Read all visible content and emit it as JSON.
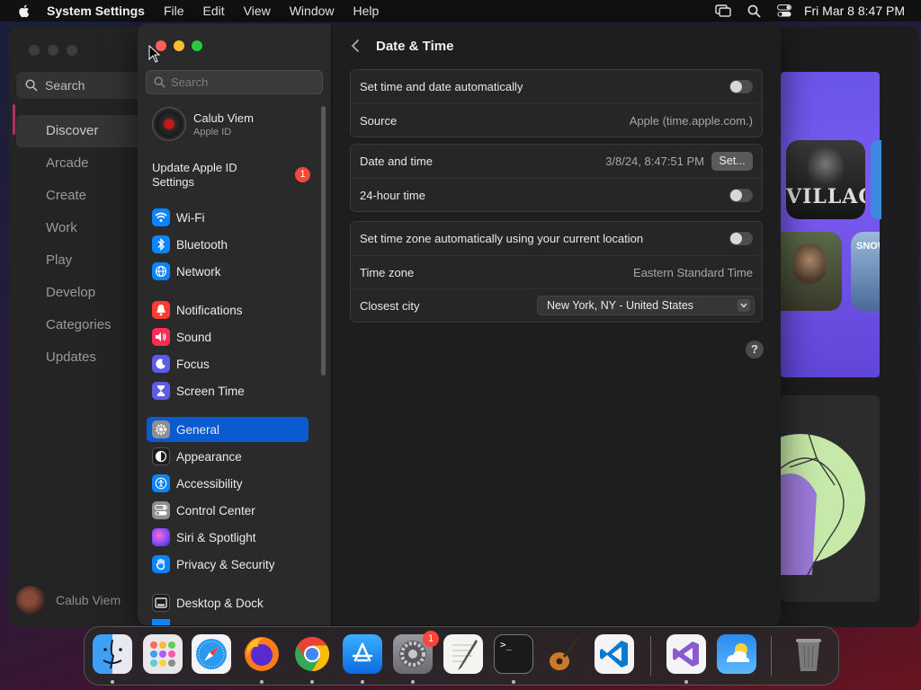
{
  "menubar": {
    "app_name": "System Settings",
    "menus": [
      "File",
      "Edit",
      "View",
      "Window",
      "Help"
    ],
    "clock": "Fri Mar 8  8:47 PM"
  },
  "bg_window": {
    "search_placeholder": "Search",
    "nav": [
      "Discover",
      "Arcade",
      "Create",
      "Work",
      "Play",
      "Develop",
      "Categories",
      "Updates"
    ],
    "active_nav": "Discover",
    "user_name": "Calub Viem",
    "tiles": {
      "village": "VILLAGE",
      "snow": "SNOW"
    }
  },
  "sidebar": {
    "search_placeholder": "Search",
    "account_name": "Calub Viem",
    "account_sub": "Apple ID",
    "update_label": "Update Apple ID Settings",
    "update_badge": "1",
    "items": [
      {
        "label": "Wi-Fi",
        "icon": "wifi-icon",
        "color": "#0a84ff"
      },
      {
        "label": "Bluetooth",
        "icon": "bluetooth-icon",
        "color": "#0a84ff"
      },
      {
        "label": "Network",
        "icon": "globe-icon",
        "color": "#0a84ff"
      },
      {
        "label": "Notifications",
        "icon": "bell-icon",
        "color": "#ff3b30"
      },
      {
        "label": "Sound",
        "icon": "speaker-icon",
        "color": "#ff2d55"
      },
      {
        "label": "Focus",
        "icon": "moon-icon",
        "color": "#5e5ce6"
      },
      {
        "label": "Screen Time",
        "icon": "hourglass-icon",
        "color": "#5e5ce6"
      },
      {
        "label": "General",
        "icon": "gear-icon",
        "color": "#8e8e93"
      },
      {
        "label": "Appearance",
        "icon": "appearance-icon",
        "color": "#1c1c1e"
      },
      {
        "label": "Accessibility",
        "icon": "accessibility-icon",
        "color": "#0a84ff"
      },
      {
        "label": "Control Center",
        "icon": "toggles-icon",
        "color": "#8e8e93"
      },
      {
        "label": "Siri & Spotlight",
        "icon": "siri-icon",
        "color": "#bf5af2"
      },
      {
        "label": "Privacy & Security",
        "icon": "hand-icon",
        "color": "#0a84ff"
      },
      {
        "label": "Desktop & Dock",
        "icon": "dock-icon",
        "color": "#1c1c1e"
      }
    ],
    "selected": "General"
  },
  "main": {
    "title": "Date & Time",
    "groups": {
      "g1": {
        "auto_label": "Set time and date automatically",
        "source_label": "Source",
        "source_value": "Apple (time.apple.com.)"
      },
      "g2": {
        "datetime_label": "Date and time",
        "datetime_value": "3/8/24, 8:47:51 PM",
        "set_button": "Set...",
        "hour24_label": "24-hour time"
      },
      "g3": {
        "tz_auto_label": "Set time zone automatically using your current location",
        "tz_label": "Time zone",
        "tz_value": "Eastern Standard Time",
        "city_label": "Closest city",
        "city_value": "New York, NY - United States"
      }
    },
    "help_glyph": "?"
  },
  "dock": {
    "apps": [
      "Finder",
      "Launchpad",
      "Safari",
      "Firefox",
      "Chrome",
      "App Store",
      "System Settings",
      "TextEdit",
      "Terminal",
      "GarageBand",
      "Visual Studio Code",
      "Visual Studio",
      "Weather",
      "Trash"
    ],
    "settings_badge": "1",
    "terminal_prompt": ">_"
  },
  "colors": {
    "accent": "#0a5ad0",
    "badge": "#ff453a",
    "traffic_red": "#ff5f57",
    "traffic_yellow": "#febc2e",
    "traffic_green": "#28c840"
  }
}
